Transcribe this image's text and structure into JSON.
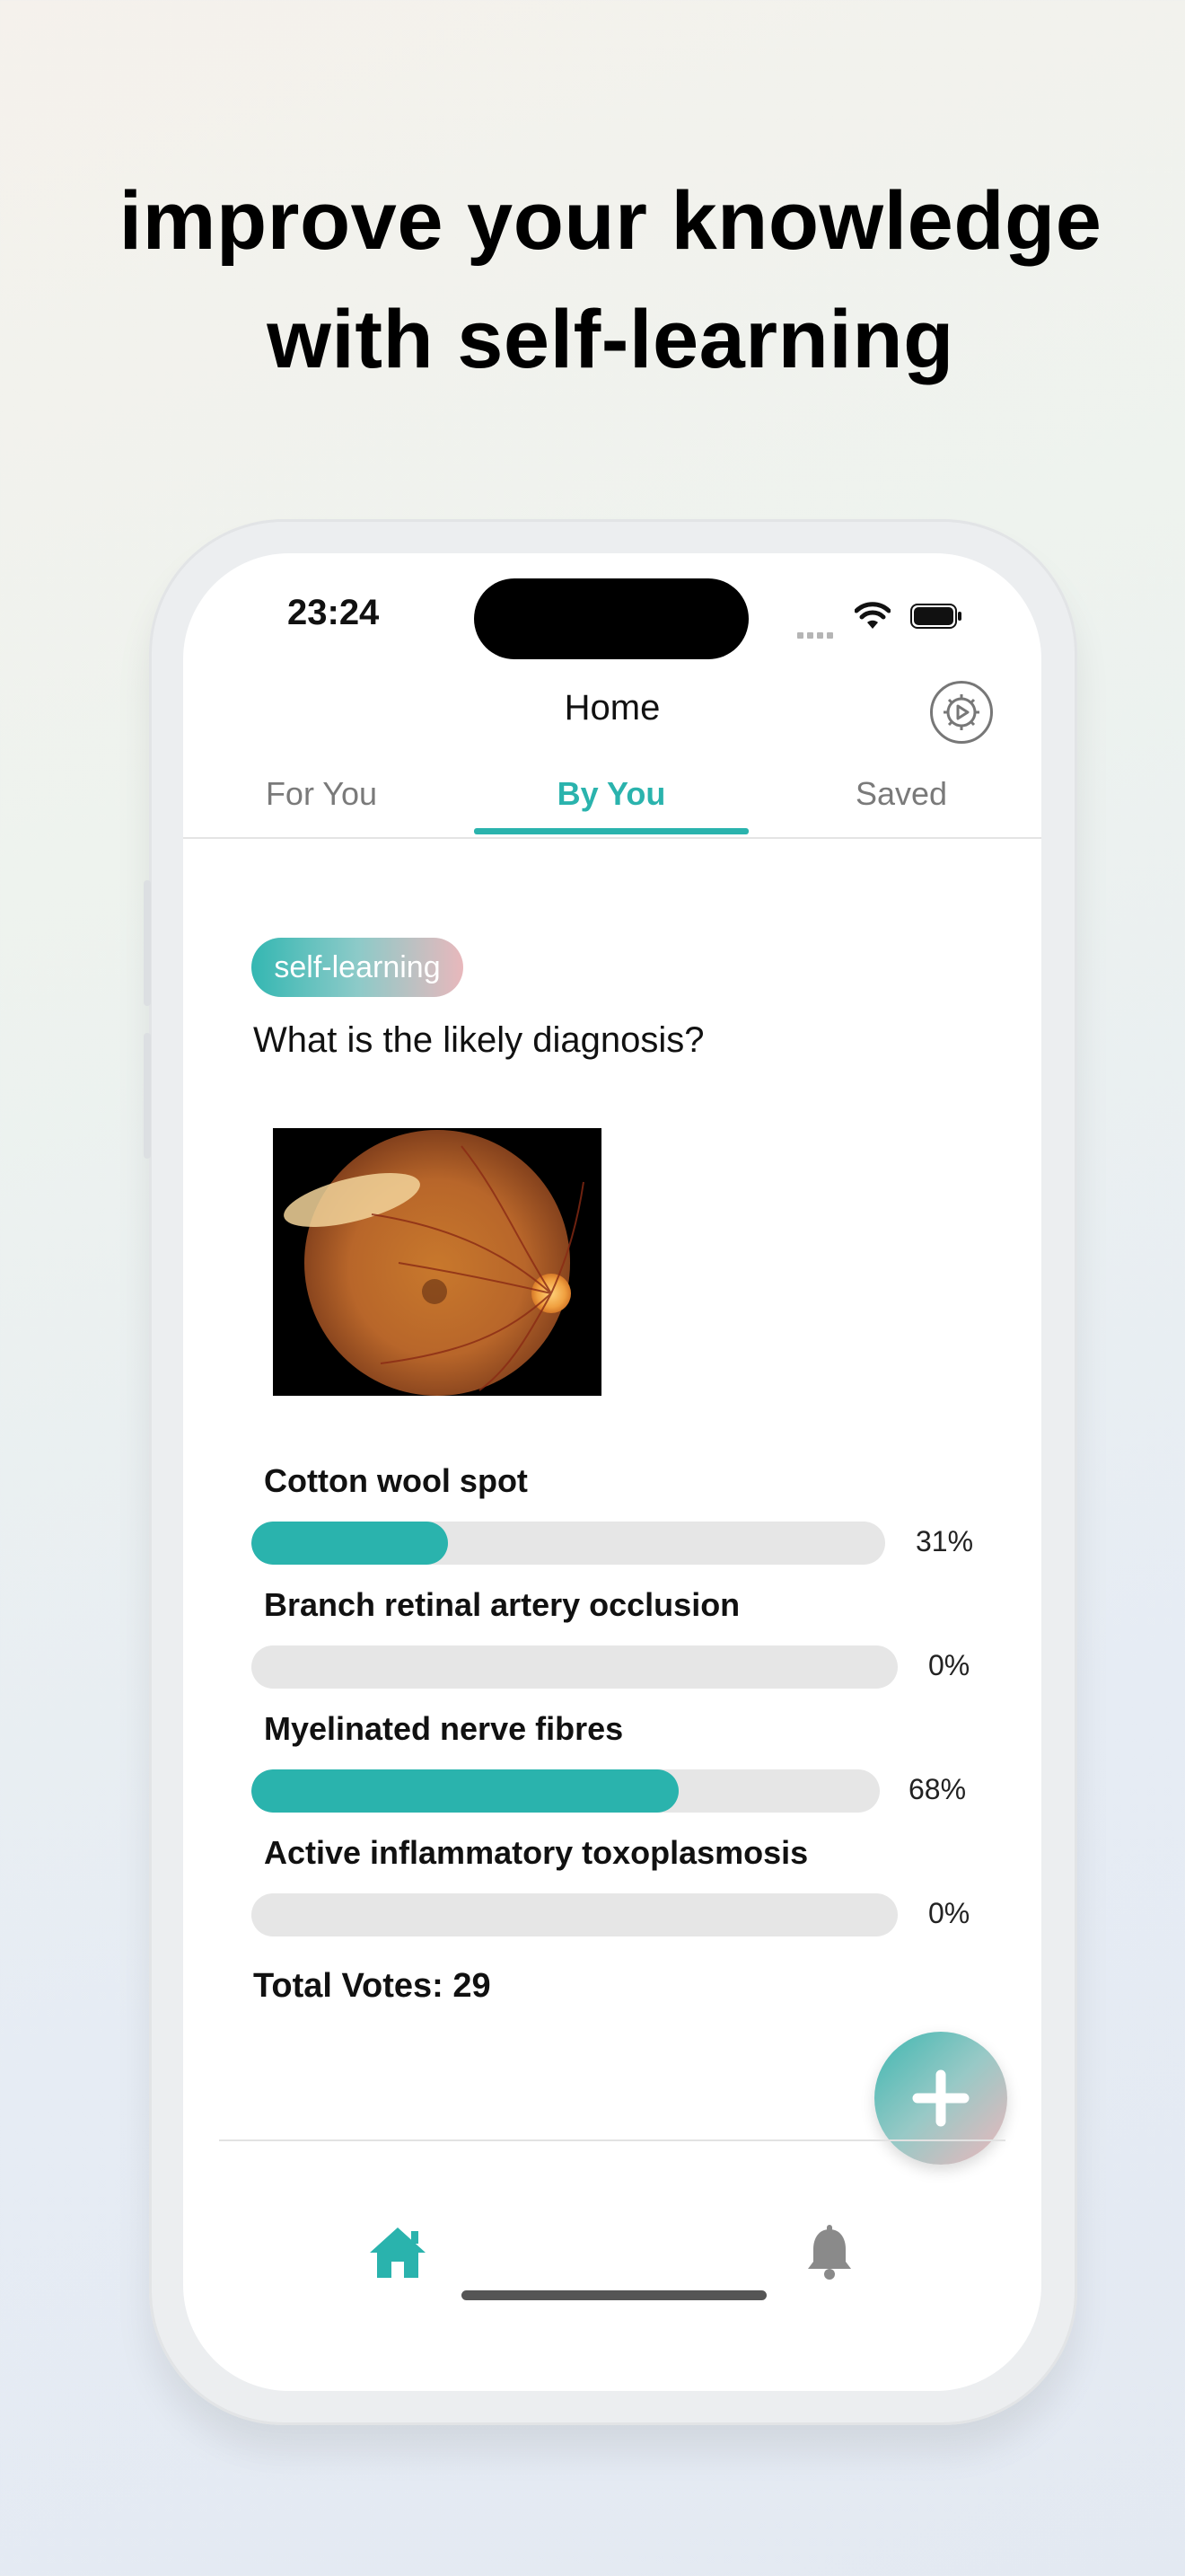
{
  "headline": {
    "line1": "improve your knowledge",
    "line2": "with self-learning"
  },
  "status_bar": {
    "time": "23:24"
  },
  "nav": {
    "title": "Home"
  },
  "tabs": [
    {
      "label": "For You",
      "active": false
    },
    {
      "label": "By You",
      "active": true
    },
    {
      "label": "Saved",
      "active": false
    }
  ],
  "post": {
    "tag": "self-learning",
    "question": "What is the likely diagnosis?",
    "options": [
      {
        "label": "Cotton wool spot",
        "percent_text": "31%",
        "percent": 31
      },
      {
        "label": "Branch retinal artery occlusion",
        "percent_text": "0%",
        "percent": 0
      },
      {
        "label": "Myelinated nerve fibres",
        "percent_text": "68%",
        "percent": 68
      },
      {
        "label": "Active inflammatory toxoplasmosis",
        "percent_text": "0%",
        "percent": 0
      }
    ],
    "total_votes": "Total Votes: 29"
  },
  "colors": {
    "accent": "#2ab3ad",
    "track": "#e6e6e6",
    "tag_gradient_end": "#e8b8bc"
  },
  "icons": {
    "settings": "settings-icon",
    "fab": "plus-icon",
    "bottom_home": "home-icon",
    "bottom_notifications": "bell-icon"
  }
}
